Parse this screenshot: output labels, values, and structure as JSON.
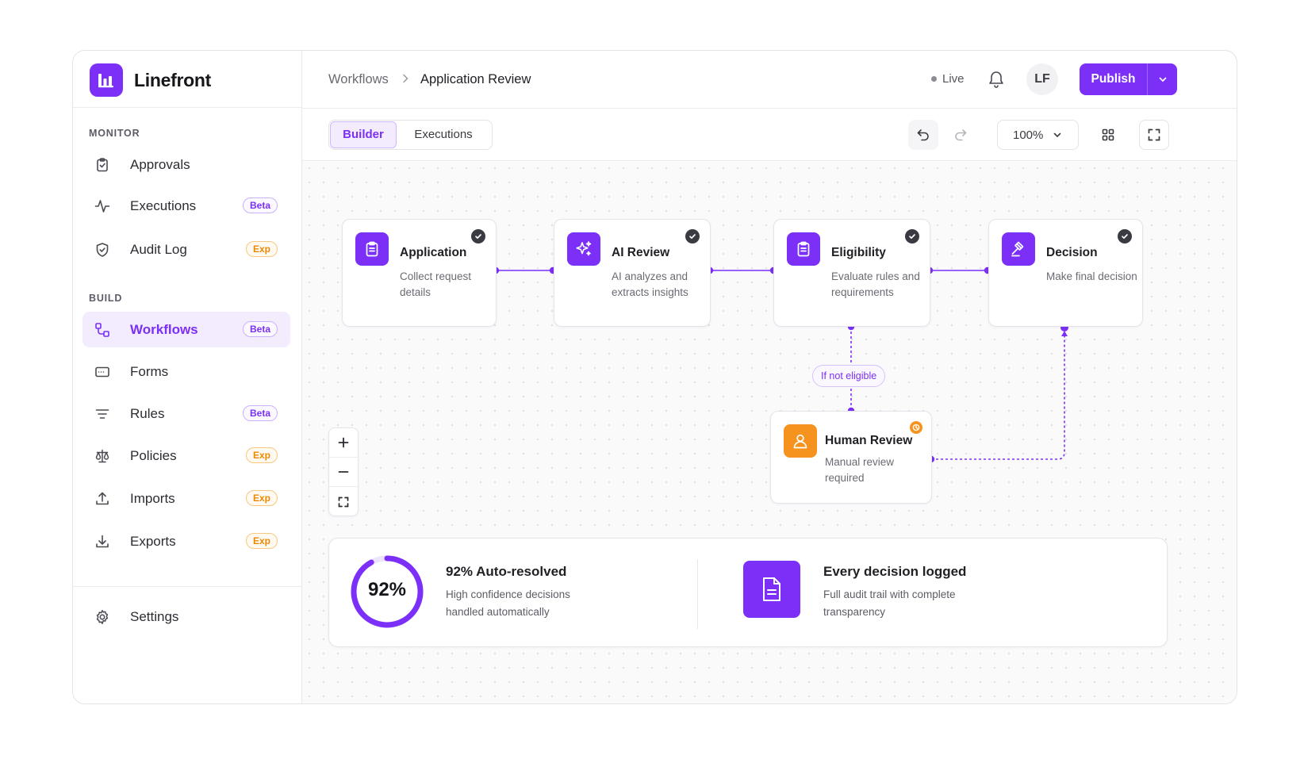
{
  "brand": {
    "name": "Linefront"
  },
  "sidebar": {
    "monitor_label": "MONITOR",
    "build_label": "BUILD",
    "monitor_items": [
      {
        "label": "Approvals",
        "icon": "clipboard-icon"
      },
      {
        "label": "Executions",
        "icon": "activity-icon",
        "badge": "Beta"
      },
      {
        "label": "Audit Log",
        "icon": "shield-icon",
        "badge": "Exp"
      }
    ],
    "build_items": [
      {
        "label": "Workflows",
        "icon": "workflow-icon",
        "badge": "Beta",
        "active": true
      },
      {
        "label": "Forms",
        "icon": "form-icon"
      },
      {
        "label": "Rules",
        "icon": "filter-icon",
        "badge": "Beta"
      },
      {
        "label": "Policies",
        "icon": "scale-icon",
        "badge": "Exp"
      },
      {
        "label": "Imports",
        "icon": "upload-icon",
        "badge": "Exp"
      },
      {
        "label": "Exports",
        "icon": "download-icon",
        "badge": "Exp"
      }
    ],
    "settings": {
      "label": "Settings",
      "icon": "gear-icon"
    }
  },
  "topbar": {
    "breadcrumb": [
      "Workflows",
      "Application Review"
    ],
    "status": "Live",
    "avatar_initials": "LF",
    "publish_label": "Publish"
  },
  "toolbar": {
    "tabs": [
      "Builder",
      "Executions"
    ],
    "active_tab": "Builder",
    "zoom": "100%"
  },
  "workflow": {
    "nodes": [
      {
        "title": "Application",
        "desc": "Collect request details",
        "icon": "clipboard-icon",
        "status": "complete"
      },
      {
        "title": "AI Review",
        "desc": "AI analyzes and extracts insights",
        "icon": "sparkles-icon",
        "status": "complete"
      },
      {
        "title": "Eligibility",
        "desc": "Evaluate rules and requirements",
        "icon": "clipboard-icon",
        "status": "complete"
      },
      {
        "title": "Decision",
        "desc": "Make final decision",
        "icon": "gavel-icon",
        "status": "complete"
      },
      {
        "title": "Human Review",
        "desc": "Manual review required",
        "icon": "user-icon",
        "status": "pending"
      }
    ],
    "condition_label": "If not eligible"
  },
  "stats": {
    "auto_percent": "92%",
    "auto_fraction": 0.92,
    "auto_title": "92% Auto-resolved",
    "auto_desc": "High confidence decisions handled automatically",
    "log_title": "Every decision logged",
    "log_desc": "Full audit trail with complete transparency"
  },
  "colors": {
    "accent": "#7b2ff7",
    "warning": "#f6921e",
    "exp_badge": "#e88a06"
  }
}
